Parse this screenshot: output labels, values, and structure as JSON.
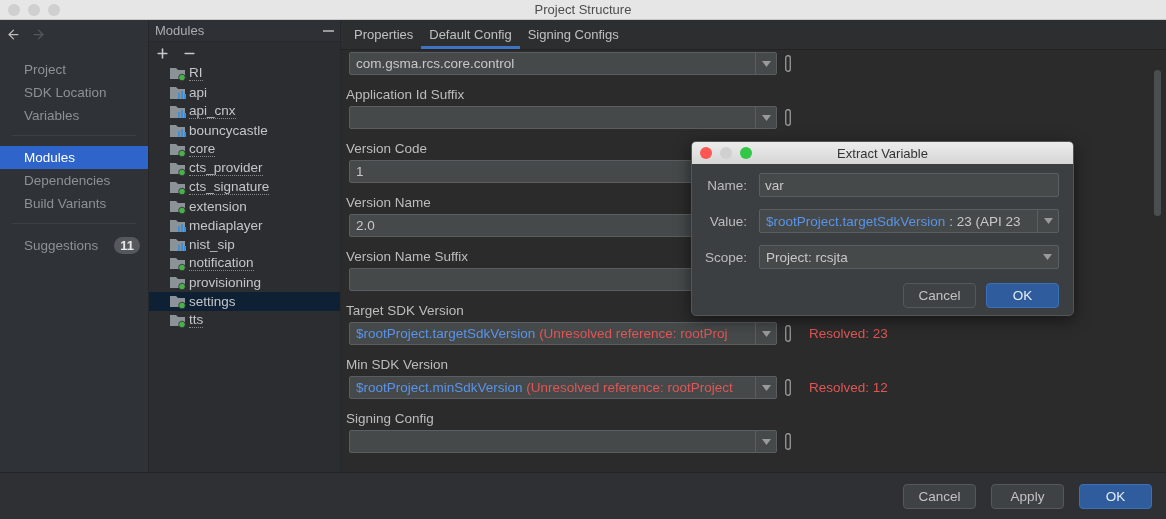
{
  "window": {
    "title": "Project Structure"
  },
  "nav": {
    "groups": [
      {
        "items": [
          {
            "label": "Project",
            "selected": false
          },
          {
            "label": "SDK Location",
            "selected": false
          },
          {
            "label": "Variables",
            "selected": false
          }
        ]
      },
      {
        "items": [
          {
            "label": "Modules",
            "selected": true
          },
          {
            "label": "Dependencies",
            "selected": false
          },
          {
            "label": "Build Variants",
            "selected": false
          }
        ]
      },
      {
        "items": [
          {
            "label": "Suggestions",
            "selected": false,
            "badge": "11"
          }
        ]
      }
    ]
  },
  "modules": {
    "title": "Modules",
    "items": [
      {
        "name": "RI",
        "kind": "module",
        "dotted_underline": true,
        "selected": false
      },
      {
        "name": "api",
        "kind": "library",
        "dotted_underline": false,
        "selected": false
      },
      {
        "name": "api_cnx",
        "kind": "library",
        "dotted_underline": true,
        "selected": false
      },
      {
        "name": "bouncycastle",
        "kind": "library",
        "dotted_underline": false,
        "selected": false
      },
      {
        "name": "core",
        "kind": "module",
        "dotted_underline": true,
        "selected": false
      },
      {
        "name": "cts_provider",
        "kind": "module",
        "dotted_underline": true,
        "selected": false
      },
      {
        "name": "cts_signature",
        "kind": "module",
        "dotted_underline": true,
        "selected": false
      },
      {
        "name": "extension",
        "kind": "module",
        "dotted_underline": false,
        "selected": false
      },
      {
        "name": "mediaplayer",
        "kind": "library",
        "dotted_underline": false,
        "selected": false
      },
      {
        "name": "nist_sip",
        "kind": "library",
        "dotted_underline": false,
        "selected": false
      },
      {
        "name": "notification",
        "kind": "module",
        "dotted_underline": true,
        "selected": false
      },
      {
        "name": "provisioning",
        "kind": "module",
        "dotted_underline": false,
        "selected": false
      },
      {
        "name": "settings",
        "kind": "module",
        "dotted_underline": false,
        "selected": true
      },
      {
        "name": "tts",
        "kind": "module",
        "dotted_underline": true,
        "selected": false
      }
    ]
  },
  "tabs": [
    {
      "label": "Properties",
      "selected": false
    },
    {
      "label": "Default Config",
      "selected": true
    },
    {
      "label": "Signing Configs",
      "selected": false
    }
  ],
  "fields": [
    {
      "kind": "combo",
      "value": "com.gsma.rcs.core.control"
    },
    {
      "kind": "combo",
      "label": "Application Id Suffix"
    },
    {
      "kind": "text",
      "label": "Version Code",
      "value": "1"
    },
    {
      "kind": "text",
      "label": "Version Name",
      "value": "2.0"
    },
    {
      "kind": "text",
      "label": "Version Name Suffix"
    },
    {
      "kind": "combo",
      "label": "Target SDK Version",
      "reference": "$rootProject.targetSdkVersion",
      "error": "(Unresolved reference: rootProj",
      "resolved": "Resolved: 23"
    },
    {
      "kind": "combo",
      "label": "Min SDK Version",
      "reference": "$rootProject.minSdkVersion",
      "error": "(Unresolved reference: rootProject",
      "resolved": "Resolved: 12"
    },
    {
      "kind": "combo",
      "label": "Signing Config"
    }
  ],
  "dialog": {
    "title": "Extract Variable",
    "name": {
      "label": "Name:",
      "value": "var"
    },
    "value": {
      "label": "Value:",
      "reference": "$rootProject.targetSdkVersion",
      "rest": ": 23 (API 23"
    },
    "scope": {
      "label": "Scope:",
      "value": "Project: rcsjta"
    },
    "buttons": [
      {
        "label": "Cancel",
        "default": false
      },
      {
        "label": "OK",
        "default": true
      }
    ]
  },
  "buttons": [
    {
      "label": "Cancel",
      "default": false
    },
    {
      "label": "Apply",
      "default": false
    },
    {
      "label": "OK",
      "default": true
    }
  ]
}
